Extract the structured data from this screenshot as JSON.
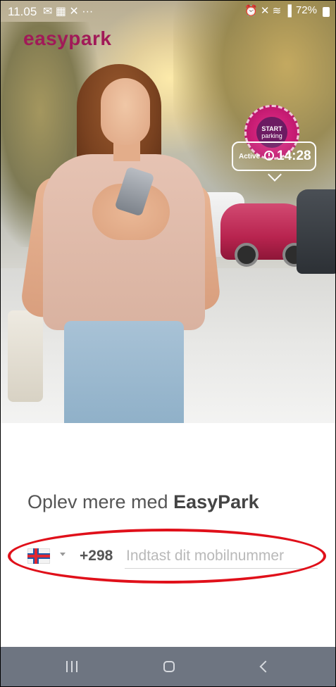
{
  "status_bar": {
    "time": "11.05",
    "left_icons": [
      "mail-icon",
      "gallery-icon",
      "missed-call-icon",
      "more-icon"
    ],
    "left_glyphs": "✉ ▦ ✕ ···",
    "right_glyphs": "⏰ ✕ ≋ ▐",
    "battery": "72%"
  },
  "logo": {
    "text": "easypark"
  },
  "hero": {
    "badge_line1": "START",
    "badge_line2": "parking",
    "active_label": "Active",
    "active_time": "14:28"
  },
  "content": {
    "headline_prefix": "Oplev mere med",
    "headline_brand": "EasyPark"
  },
  "phone_entry": {
    "country_flag": "faroe-islands-flag",
    "country_code": "+298",
    "placeholder": "Indtast dit mobilnummer",
    "value": ""
  },
  "colors": {
    "brand": "#c32468",
    "highlight": "#e0101a",
    "navbar": "#6e7581"
  }
}
